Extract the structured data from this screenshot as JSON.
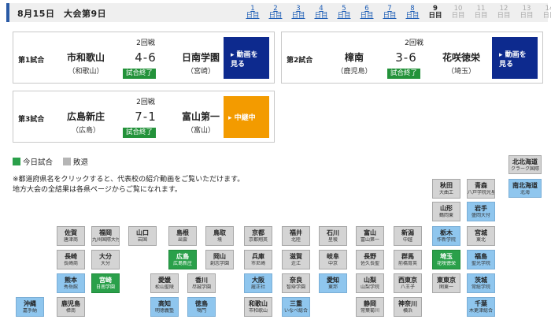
{
  "header": {
    "title": "8月15日　大会第9日",
    "days": [
      {
        "n": "1",
        "u": "日目",
        "state": "link"
      },
      {
        "n": "2",
        "u": "日目",
        "state": "link"
      },
      {
        "n": "3",
        "u": "日目",
        "state": "link"
      },
      {
        "n": "4",
        "u": "日目",
        "state": "link"
      },
      {
        "n": "5",
        "u": "日目",
        "state": "link"
      },
      {
        "n": "6",
        "u": "日目",
        "state": "link"
      },
      {
        "n": "7",
        "u": "日目",
        "state": "link"
      },
      {
        "n": "8",
        "u": "日目",
        "state": "link"
      },
      {
        "n": "9",
        "u": "日目",
        "state": "current"
      },
      {
        "n": "10",
        "u": "日目",
        "state": "future"
      },
      {
        "n": "11",
        "u": "日目",
        "state": "future"
      },
      {
        "n": "12",
        "u": "日目",
        "state": "future"
      },
      {
        "n": "13",
        "u": "日目",
        "state": "future"
      },
      {
        "n": "14",
        "u": "日目",
        "state": "future"
      }
    ]
  },
  "games": [
    {
      "no": "第1試合",
      "round": "2回戦",
      "home": "市和歌山",
      "home_pref": "（和歌山）",
      "score": "4-6",
      "away": "日南学園",
      "away_pref": "（宮崎）",
      "status": "試合終了",
      "button": "動画を\n見る",
      "button_color": "#0d2a8e"
    },
    {
      "no": "第2試合",
      "round": "2回戦",
      "home": "樟南",
      "home_pref": "（鹿児島）",
      "score": "3-6",
      "away": "花咲徳栄",
      "away_pref": "（埼玉）",
      "status": "試合終了",
      "button": "動画を\n見る",
      "button_color": "#0d2a8e"
    },
    {
      "no": "第3試合",
      "round": "2回戦",
      "home": "広島新庄",
      "home_pref": "（広島）",
      "score": "7-1",
      "away": "富山第一",
      "away_pref": "（富山）",
      "status": "試合終了",
      "button": "中継中",
      "button_color": "#f39b00"
    }
  ],
  "legend": {
    "today": "今日試合",
    "lost": "敗退",
    "today_color": "#2aa04a",
    "lost_color": "#b5b5b5"
  },
  "note": "※都道府県名をクリックすると、代表校の紹介動画をご覧いただけます。\n地方大会の全結果は各県ページからご覧になれます。",
  "colors": {
    "active": "#8fc6ee",
    "lost": "#d4d4d4",
    "today": "#2aa04a",
    "accent": "#0d2a8e"
  },
  "map": [
    {
      "p": "北北海道",
      "s": "クラーク国際",
      "state": "lost"
    },
    {
      "p": "南北海道",
      "s": "北海",
      "state": "active"
    },
    {
      "p": "秋田",
      "s": "大曲工",
      "state": "lost"
    },
    {
      "p": "青森",
      "s": "八戸学院光星",
      "state": "lost"
    },
    {
      "p": "山形",
      "s": "鶴岡東",
      "state": "lost"
    },
    {
      "p": "岩手",
      "s": "盛岡大付",
      "state": "active"
    },
    {
      "p": "佐賀",
      "s": "唐津商",
      "state": "lost"
    },
    {
      "p": "福岡",
      "s": "九州国際大付",
      "state": "lost"
    },
    {
      "p": "山口",
      "s": "岩国",
      "state": "lost"
    },
    {
      "p": "島根",
      "s": "出雲",
      "state": "lost"
    },
    {
      "p": "鳥取",
      "s": "境",
      "state": "lost"
    },
    {
      "p": "京都",
      "s": "京都翔英",
      "state": "lost"
    },
    {
      "p": "福井",
      "s": "北陸",
      "state": "lost"
    },
    {
      "p": "石川",
      "s": "星稜",
      "state": "lost"
    },
    {
      "p": "富山",
      "s": "富山第一",
      "state": "lost"
    },
    {
      "p": "新潟",
      "s": "中越",
      "state": "lost"
    },
    {
      "p": "栃木",
      "s": "作新学院",
      "state": "active"
    },
    {
      "p": "宮城",
      "s": "東北",
      "state": "lost"
    },
    {
      "p": "長崎",
      "s": "長崎商",
      "state": "lost"
    },
    {
      "p": "大分",
      "s": "大分",
      "state": "lost"
    },
    {
      "p": "広島",
      "s": "広島新庄",
      "state": "today"
    },
    {
      "p": "岡山",
      "s": "創志学園",
      "state": "lost"
    },
    {
      "p": "兵庫",
      "s": "市尼崎",
      "state": "lost"
    },
    {
      "p": "滋賀",
      "s": "近江",
      "state": "lost"
    },
    {
      "p": "岐阜",
      "s": "中京",
      "state": "lost"
    },
    {
      "p": "長野",
      "s": "佐久長聖",
      "state": "lost"
    },
    {
      "p": "群馬",
      "s": "前橋育英",
      "state": "lost"
    },
    {
      "p": "埼玉",
      "s": "花咲徳栄",
      "state": "today"
    },
    {
      "p": "福島",
      "s": "聖光学院",
      "state": "active"
    },
    {
      "p": "熊本",
      "s": "秀岳館",
      "state": "active"
    },
    {
      "p": "宮崎",
      "s": "日南学園",
      "state": "today"
    },
    {
      "p": "愛媛",
      "s": "松山聖陵",
      "state": "lost"
    },
    {
      "p": "香川",
      "s": "尽誠学園",
      "state": "lost"
    },
    {
      "p": "大阪",
      "s": "履正社",
      "state": "active"
    },
    {
      "p": "奈良",
      "s": "智辯学園",
      "state": "lost"
    },
    {
      "p": "愛知",
      "s": "東邦",
      "state": "active"
    },
    {
      "p": "山梨",
      "s": "山梨学院",
      "state": "lost"
    },
    {
      "p": "西東京",
      "s": "八王子",
      "state": "lost"
    },
    {
      "p": "東東京",
      "s": "関東一",
      "state": "lost"
    },
    {
      "p": "茨城",
      "s": "常総学院",
      "state": "active"
    },
    {
      "p": "沖縄",
      "s": "嘉手納",
      "state": "active"
    },
    {
      "p": "鹿児島",
      "s": "樟南",
      "state": "lost"
    },
    {
      "p": "高知",
      "s": "明徳義塾",
      "state": "active"
    },
    {
      "p": "徳島",
      "s": "鳴門",
      "state": "active"
    },
    {
      "p": "和歌山",
      "s": "市和歌山",
      "state": "lost"
    },
    {
      "p": "三重",
      "s": "いなべ総合",
      "state": "active"
    },
    {
      "p": "静岡",
      "s": "常葉菊川",
      "state": "lost"
    },
    {
      "p": "神奈川",
      "s": "横浜",
      "state": "lost"
    },
    {
      "p": "千葉",
      "s": "木更津総合",
      "state": "active"
    }
  ]
}
